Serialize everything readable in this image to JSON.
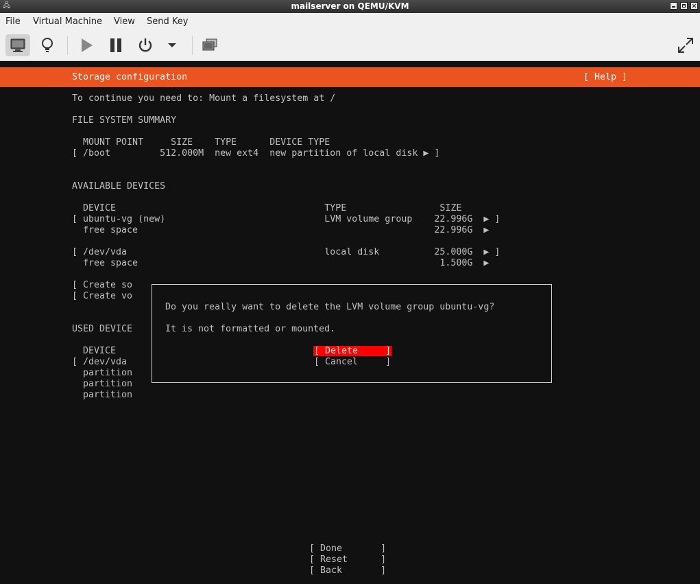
{
  "window": {
    "title": "mailserver on QEMU/KVM"
  },
  "menu": [
    "File",
    "Virtual Machine",
    "View",
    "Send Key"
  ],
  "toolbar": {
    "buttons": [
      "console-icon",
      "lightbulb-icon",
      "play-icon",
      "pause-icon",
      "power-icon",
      "dropdown-arrow-icon",
      "screenshots-icon",
      "fullscreen-icon"
    ]
  },
  "installer": {
    "header": "Storage configuration",
    "help": "[ Help ]",
    "instruction": "To continue you need to: Mount a filesystem at /",
    "fs_summary": {
      "title": "FILE SYSTEM SUMMARY",
      "header": "  MOUNT POINT     SIZE    TYPE      DEVICE TYPE",
      "rows": [
        "[ /boot         512.000M  new ext4  new partition of local disk ▶ ]"
      ]
    },
    "available": {
      "title": "AVAILABLE DEVICES",
      "header": "  DEVICE                                      TYPE                 SIZE",
      "rows": [
        "[ ubuntu-vg (new)                             LVM volume group    22.996G  ▶ ]",
        "  free space                                                      22.996G  ▶",
        "",
        "[ /dev/vda                                    local disk          25.000G  ▶ ]",
        "  free space                                                       1.500G  ▶",
        "",
        "[ Create so",
        "[ Create vo"
      ]
    },
    "used": {
      "title": "USED DEVICE",
      "rows": [
        "  DEVICE",
        "[ /dev/vda",
        "  partition",
        "  partition",
        "  partition"
      ]
    },
    "bottom_buttons": [
      "[ Done       ]",
      "[ Reset      ]",
      "[ Back       ]"
    ]
  },
  "dialog": {
    "message": "Do you really want to delete the LVM volume group ubuntu-vg?",
    "sub": "It is not formatted or mounted.",
    "delete_label": "[ Delete     ]",
    "cancel_label": "[ Cancel     ]"
  },
  "colors": {
    "header_bar": "#e95420",
    "focus": "#ff0000",
    "terminal_bg": "#111111"
  }
}
